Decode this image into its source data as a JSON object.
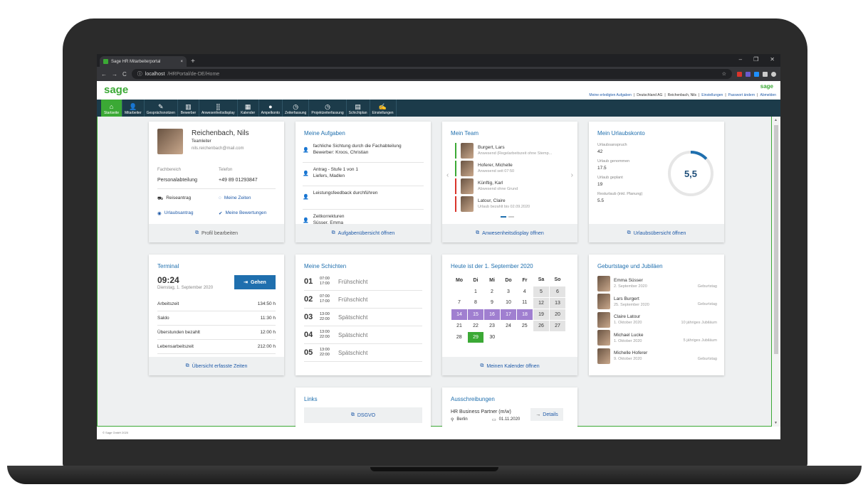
{
  "browser": {
    "tab_title": "Sage HR Mitarbeiterportal",
    "tab_close": "×",
    "new_tab": "+",
    "url_host": "localhost",
    "url_path": "/HRPortal/de-DE/Home",
    "min": "–",
    "max": "❐",
    "close": "✕"
  },
  "header": {
    "logo": "sage",
    "logo_small": "sage",
    "links": [
      {
        "label": "Meine erledigten Aufgaben",
        "link": true
      },
      {
        "label": "Deutschland AG",
        "link": false
      },
      {
        "label": "Reichenbach, Nils",
        "link": false
      },
      {
        "label": "Einstellungen",
        "link": true
      },
      {
        "label": "Passwort ändern",
        "link": true
      },
      {
        "label": "Abmelden",
        "link": true
      }
    ]
  },
  "nav": [
    {
      "label": "Startseite",
      "icon": "⌂",
      "active": true
    },
    {
      "label": "Mitarbeiter",
      "icon": "👤"
    },
    {
      "label": "Gesprächsnotizen",
      "icon": "✎"
    },
    {
      "label": "Bewerber",
      "icon": "▥"
    },
    {
      "label": "Anwesenheitsdisplay",
      "icon": "⣿"
    },
    {
      "label": "Kalender",
      "icon": "▦"
    },
    {
      "label": "Ampelkonto",
      "icon": "●"
    },
    {
      "label": "Zeiterfassung",
      "icon": "◷"
    },
    {
      "label": "Projektzeiterfassung",
      "icon": "◷"
    },
    {
      "label": "Schichtplan",
      "icon": "▤"
    },
    {
      "label": "Einstellungen",
      "icon": "✍"
    }
  ],
  "profile": {
    "name": "Reichenbach, Nils",
    "role": "Teamleiter",
    "email": "nils.reichenbach@mail.com",
    "dept_label": "Fachbereich",
    "dept": "Personalabteilung",
    "phone_label": "Telefon",
    "phone": "+49 89 01293847",
    "actions": [
      {
        "label": "Reiseantrag",
        "icon": "⛟",
        "link": false
      },
      {
        "label": "Meine Zeiten",
        "icon": "◌",
        "link": true
      },
      {
        "label": "Urlaubsantrag",
        "icon": "◉",
        "link": true
      },
      {
        "label": "Meine Bewertungen",
        "icon": "✔",
        "link": true
      }
    ],
    "footer": "Profil bearbeiten"
  },
  "tasks": {
    "title": "Meine Aufgaben",
    "items": [
      {
        "t": "fachliche Sichtung durch die Fachabteilung",
        "s": "Bewerber: Kroos, Christian"
      },
      {
        "t": "Antrag - Stufe 1 von 1",
        "s": "Liefers, Madlen"
      },
      {
        "t": "Leistungsfeedback durchführen",
        "s": ""
      },
      {
        "t": "Zeitkorrekturen",
        "s": "Süsser, Emma"
      }
    ],
    "footer": "Aufgabenübersicht öffnen"
  },
  "team": {
    "title": "Mein Team",
    "members": [
      {
        "name": "Burgert, Lars",
        "status": "Anwesend (Regelarbeitszeit ohne Stemp...",
        "color": "#3ba935"
      },
      {
        "name": "Hoferer, Michelle",
        "status": "Anwesend seit 07:50",
        "color": "#3ba935"
      },
      {
        "name": "Künftig, Karl",
        "status": "Abwesend ohne Grund",
        "color": "#d9342b"
      },
      {
        "name": "Latour, Claire",
        "status": "Urlaub bezahlt bis 02.09.2020",
        "color": "#d9342b"
      }
    ],
    "prev": "‹",
    "next": "›",
    "footer": "Anwesenheitsdisplay öffnen"
  },
  "vacation": {
    "title": "Mein Urlaubskonto",
    "rows": [
      {
        "l": "Urlaubsanspruch",
        "v": "42"
      },
      {
        "l": "Urlaub genommen",
        "v": "17.5"
      },
      {
        "l": "Urlaub geplant",
        "v": "19"
      },
      {
        "l": "Resturlaub (inkl. Planung)",
        "v": "5.5"
      }
    ],
    "remaining": "5,5",
    "ring_fraction": 0.13,
    "footer": "Urlaubsübersicht öffnen"
  },
  "terminal": {
    "title": "Terminal",
    "time": "09:24",
    "date": "Dienstag, 1. September 2020",
    "button": "Gehen",
    "rows": [
      {
        "l": "Arbeitszeit",
        "v": "134:50 h"
      },
      {
        "l": "Saldo",
        "v": "11:30 h"
      },
      {
        "l": "Überstunden bezahlt",
        "v": "12:00 h"
      },
      {
        "l": "Lebensarbeitszeit",
        "v": "212:00 h"
      }
    ],
    "footer": "Übersicht erfasste Zeiten"
  },
  "shifts": {
    "title": "Meine Schichten",
    "items": [
      {
        "d": "01",
        "from": "07:00",
        "to": "17:00",
        "n": "Frühschicht"
      },
      {
        "d": "02",
        "from": "07:00",
        "to": "17:00",
        "n": "Frühschicht"
      },
      {
        "d": "03",
        "from": "13:00",
        "to": "22:00",
        "n": "Spätschicht"
      },
      {
        "d": "04",
        "from": "13:00",
        "to": "22:00",
        "n": "Spätschicht"
      },
      {
        "d": "05",
        "from": "13:00",
        "to": "22:00",
        "n": "Spätschicht"
      }
    ]
  },
  "calendar": {
    "title": "Heute ist der 1. September 2020",
    "days": [
      "Mo",
      "Di",
      "Mi",
      "Do",
      "Fr",
      "Sa",
      "So"
    ],
    "weeks": [
      [
        "",
        "1",
        "2",
        "3",
        "4",
        "5",
        "6"
      ],
      [
        "7",
        "8",
        "9",
        "10",
        "11",
        "12",
        "13"
      ],
      [
        "14",
        "15",
        "16",
        "17",
        "18",
        "19",
        "20"
      ],
      [
        "21",
        "22",
        "23",
        "24",
        "25",
        "26",
        "27"
      ],
      [
        "28",
        "29",
        "30",
        "",
        "",
        "",
        ""
      ]
    ],
    "vacation_days": [
      "14",
      "15",
      "16",
      "17",
      "18"
    ],
    "today": "29",
    "footer": "Meinen Kalender öffnen"
  },
  "birthdays": {
    "title": "Geburtstage und Jubiläen",
    "items": [
      {
        "n": "Emma Süsser",
        "d": "2. September 2020",
        "t": "Geburtstag"
      },
      {
        "n": "Lars Burgert",
        "d": "25. September 2020",
        "t": "Geburtstag"
      },
      {
        "n": "Claire Latour",
        "d": "1. Oktober 2020",
        "t": "10 jähriges Jubiläum"
      },
      {
        "n": "Michael Lucke",
        "d": "1. Oktober 2020",
        "t": "5 jähriges Jubiläum"
      },
      {
        "n": "Michelle Hoferer",
        "d": "9. Oktober 2020",
        "t": "Geburtstag"
      }
    ]
  },
  "links": {
    "title": "Links",
    "item": "DSGVO"
  },
  "jobs": {
    "title": "Ausschreibungen",
    "job": "HR Business Partner (m/w)",
    "location": "Berlin",
    "date": "01.11.2020",
    "details": "Details"
  },
  "footer": "© Sage GmbH 2020",
  "colors": {
    "brand": "#3ba935",
    "nav": "#1c3b4a",
    "link": "#1f6fae",
    "vacation": "#a07fd0"
  }
}
